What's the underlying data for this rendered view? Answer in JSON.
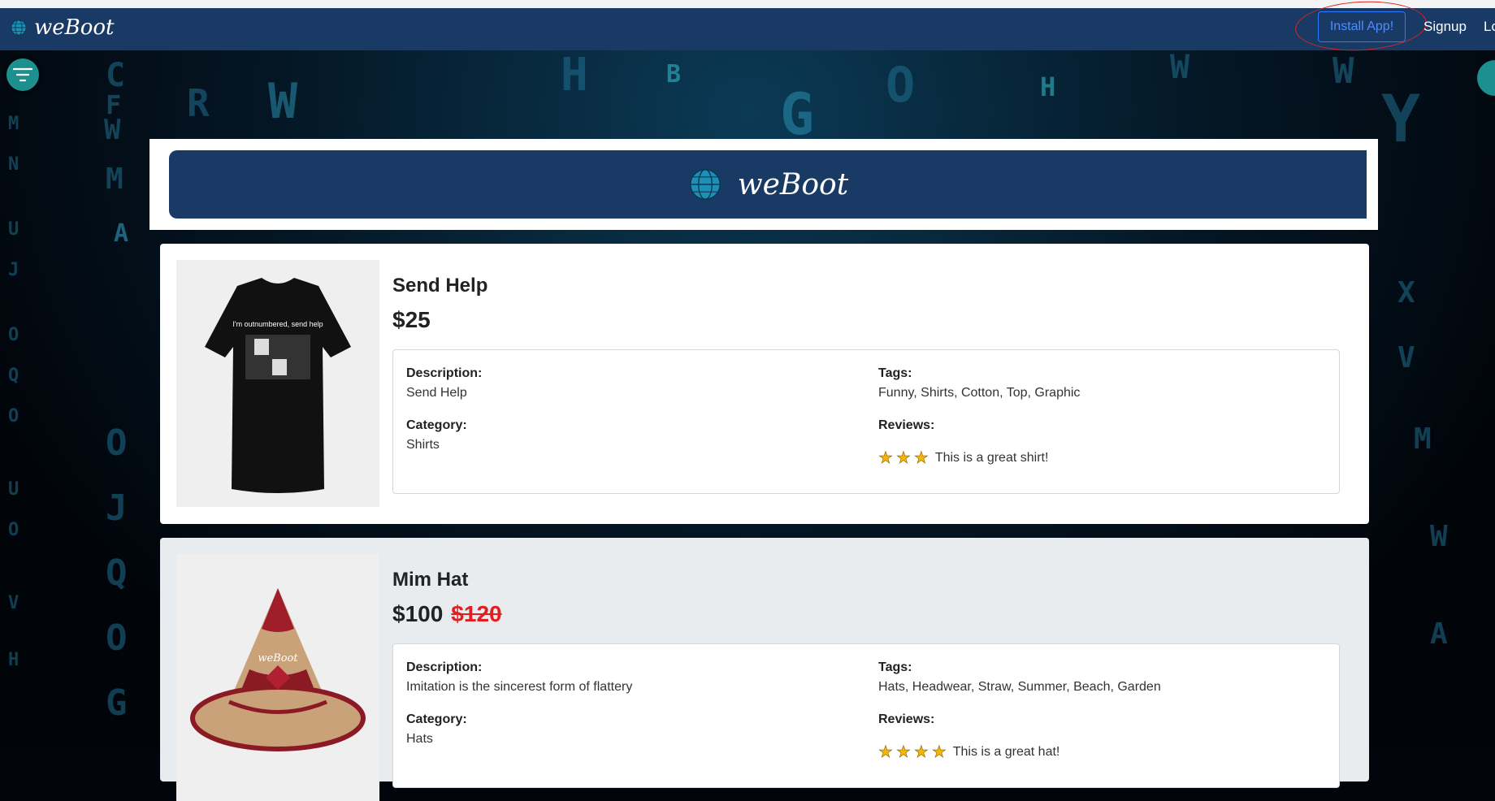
{
  "brand": {
    "name": "weBoot"
  },
  "navbar": {
    "install_label": "Install App!",
    "signup_label": "Signup",
    "login_label": "Lo"
  },
  "header": {
    "title": "weBoot"
  },
  "labels": {
    "description": "Description:",
    "category": "Category:",
    "tags": "Tags:",
    "reviews": "Reviews:"
  },
  "products": [
    {
      "name": "Send Help",
      "price": "$25",
      "old_price": "",
      "description": "Send Help",
      "category": "Shirts",
      "tags": "Funny, Shirts, Cotton, Top, Graphic",
      "review_stars": 3,
      "review_text": "This is a great shirt!",
      "image_text": "I'm outnumbered, send help"
    },
    {
      "name": "Mim Hat",
      "price": "$100",
      "old_price": "$120",
      "description": "Imitation is the sincerest form of flattery",
      "category": "Hats",
      "tags": "Hats, Headwear, Straw, Summer, Beach, Garden",
      "review_stars": 4,
      "review_text": "This is a great hat!",
      "image_text": "weBoot"
    }
  ],
  "colors": {
    "navbar": "#1a3a66",
    "accent": "#1d8f8f",
    "install": "#2f7bff",
    "sale": "#e02020"
  }
}
